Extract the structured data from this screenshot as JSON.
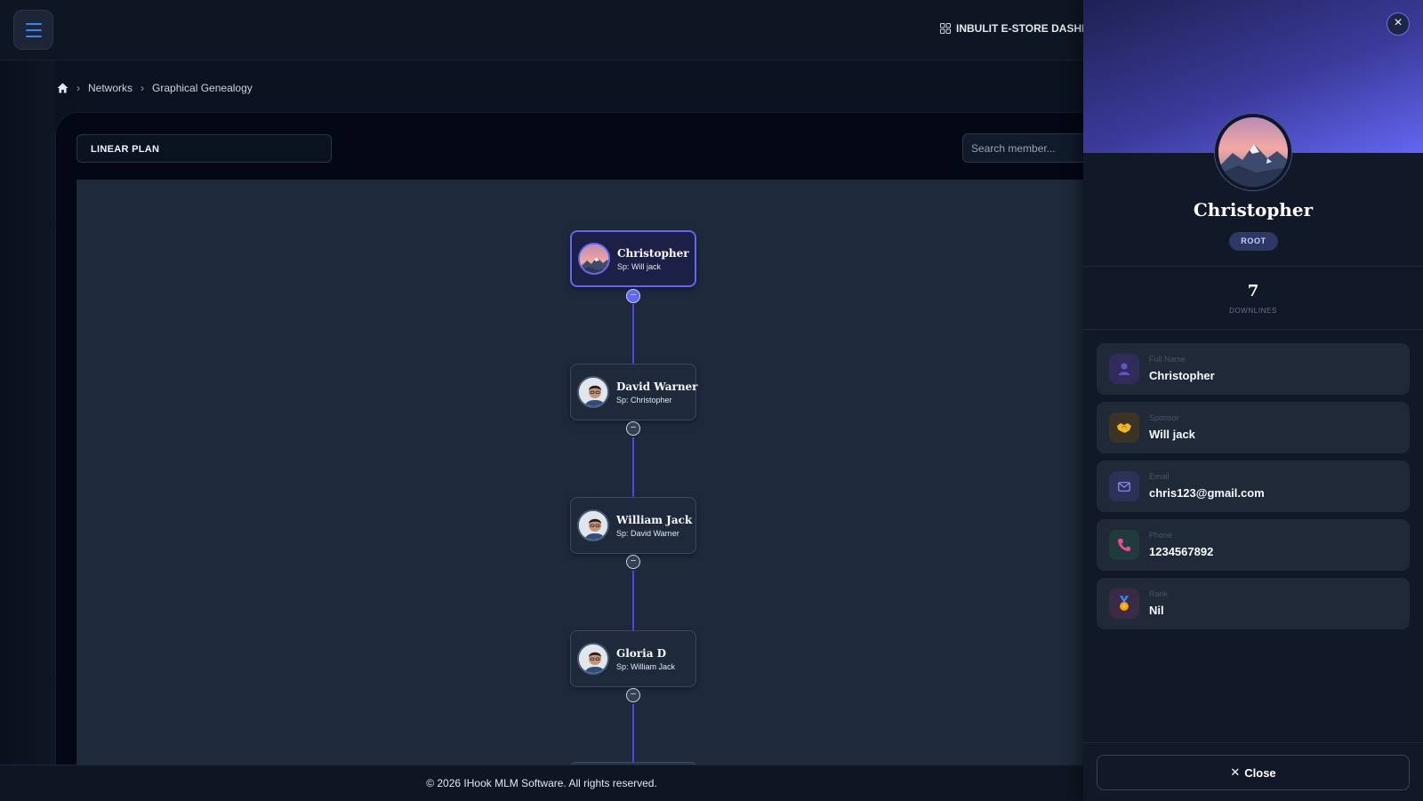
{
  "header": {
    "store_link_label": "INBULIT E-STORE DASHBO"
  },
  "breadcrumb": {
    "items": [
      "Networks",
      "Graphical Genealogy"
    ]
  },
  "controls": {
    "plan_label": "LINEAR PLAN",
    "search_placeholder": "Search member..."
  },
  "tree": {
    "nodes": [
      {
        "name": "Christopher",
        "sponsor": "Sp: Will jack"
      },
      {
        "name": "David Warner",
        "sponsor": "Sp: Christopher"
      },
      {
        "name": "William Jack",
        "sponsor": "Sp: David Warner"
      },
      {
        "name": "Gloria D",
        "sponsor": "Sp: William Jack"
      }
    ],
    "toggle_symbol": "–"
  },
  "footer": {
    "copyright": "© 2026 IHook MLM Software. All rights reserved."
  },
  "panel": {
    "name": "Christopher",
    "badge": "ROOT",
    "downlines_count": "7",
    "downlines_label": "DOWNLINES",
    "fields": [
      {
        "label": "Full Name",
        "value": "Christopher",
        "icon": "user-icon"
      },
      {
        "label": "Sponsor",
        "value": "Will jack",
        "icon": "handshake-icon"
      },
      {
        "label": "Email",
        "value": "chris123@gmail.com",
        "icon": "mail-icon"
      },
      {
        "label": "Phone",
        "value": "1234567892",
        "icon": "phone-icon"
      },
      {
        "label": "Rank",
        "value": "Nil",
        "icon": "medal-icon"
      }
    ],
    "close_label": "Close"
  },
  "colors": {
    "accent": "#6366f1",
    "background": "#0b1220",
    "canvas": "#1e293b"
  }
}
